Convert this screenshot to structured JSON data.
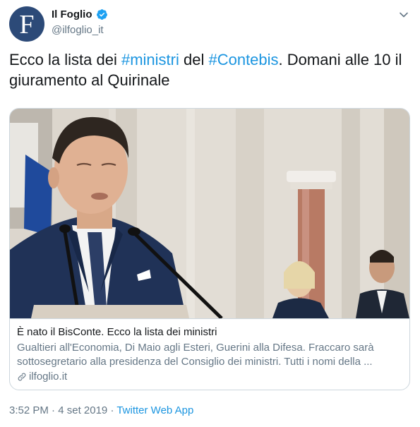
{
  "author": {
    "name": "Il Foglio",
    "handle": "@ilfoglio_it",
    "avatar_letter": "F",
    "avatar_color": "#2c4a78",
    "verified": true
  },
  "tweet": {
    "text_parts": [
      {
        "text": "Ecco la lista dei ",
        "type": "text"
      },
      {
        "text": "#ministri",
        "type": "hashtag"
      },
      {
        "text": " del ",
        "type": "text"
      },
      {
        "text": "#Contebis",
        "type": "hashtag"
      },
      {
        "text": ". Domani alle 10 il giuramento al Quirinale",
        "type": "text"
      }
    ],
    "hashtag_color": "#1b95e0"
  },
  "card": {
    "title": "È nato il BisConte. Ecco la lista dei ministri",
    "description": "Gualtieri all'Economia, Di Maio agli Esteri, Guerini alla Difesa. Fraccaro sarà sottosegretario alla presidenza del Consiglio dei ministri. Tutti i nomi della ...",
    "domain": "ilfoglio.it"
  },
  "footer": {
    "time": "3:52 PM",
    "separator1": " · ",
    "date": "4 set 2019",
    "separator2": " · ",
    "source": "Twitter Web App"
  },
  "icons": {
    "verified": "verified-badge-icon",
    "caret": "chevron-down-icon",
    "link": "link-icon"
  }
}
